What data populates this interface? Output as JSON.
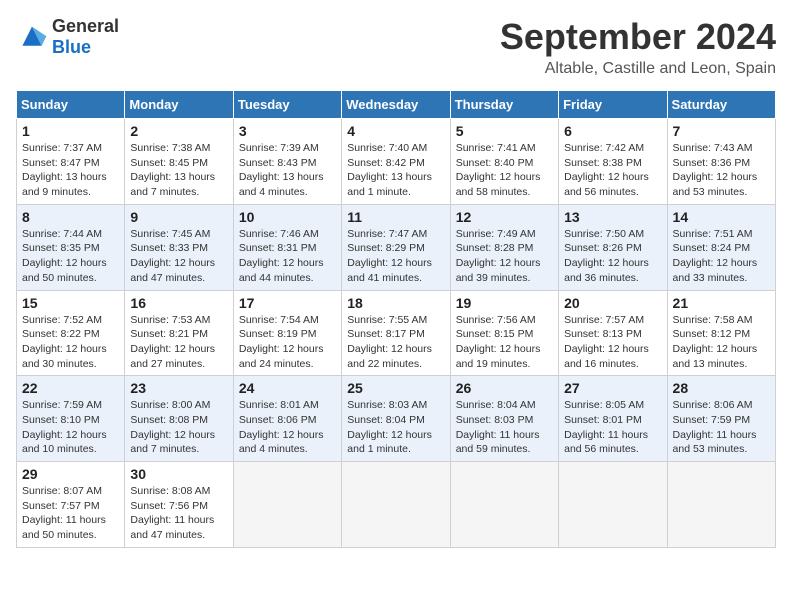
{
  "header": {
    "logo": {
      "general": "General",
      "blue": "Blue"
    },
    "title": "September 2024",
    "location": "Altable, Castille and Leon, Spain"
  },
  "calendar": {
    "headers": [
      "Sunday",
      "Monday",
      "Tuesday",
      "Wednesday",
      "Thursday",
      "Friday",
      "Saturday"
    ],
    "weeks": [
      [
        {
          "day": "1",
          "sunrise": "7:37 AM",
          "sunset": "8:47 PM",
          "daylight": "13 hours and 9 minutes."
        },
        {
          "day": "2",
          "sunrise": "7:38 AM",
          "sunset": "8:45 PM",
          "daylight": "13 hours and 7 minutes."
        },
        {
          "day": "3",
          "sunrise": "7:39 AM",
          "sunset": "8:43 PM",
          "daylight": "13 hours and 4 minutes."
        },
        {
          "day": "4",
          "sunrise": "7:40 AM",
          "sunset": "8:42 PM",
          "daylight": "13 hours and 1 minute."
        },
        {
          "day": "5",
          "sunrise": "7:41 AM",
          "sunset": "8:40 PM",
          "daylight": "12 hours and 58 minutes."
        },
        {
          "day": "6",
          "sunrise": "7:42 AM",
          "sunset": "8:38 PM",
          "daylight": "12 hours and 56 minutes."
        },
        {
          "day": "7",
          "sunrise": "7:43 AM",
          "sunset": "8:36 PM",
          "daylight": "12 hours and 53 minutes."
        }
      ],
      [
        {
          "day": "8",
          "sunrise": "7:44 AM",
          "sunset": "8:35 PM",
          "daylight": "12 hours and 50 minutes."
        },
        {
          "day": "9",
          "sunrise": "7:45 AM",
          "sunset": "8:33 PM",
          "daylight": "12 hours and 47 minutes."
        },
        {
          "day": "10",
          "sunrise": "7:46 AM",
          "sunset": "8:31 PM",
          "daylight": "12 hours and 44 minutes."
        },
        {
          "day": "11",
          "sunrise": "7:47 AM",
          "sunset": "8:29 PM",
          "daylight": "12 hours and 41 minutes."
        },
        {
          "day": "12",
          "sunrise": "7:49 AM",
          "sunset": "8:28 PM",
          "daylight": "12 hours and 39 minutes."
        },
        {
          "day": "13",
          "sunrise": "7:50 AM",
          "sunset": "8:26 PM",
          "daylight": "12 hours and 36 minutes."
        },
        {
          "day": "14",
          "sunrise": "7:51 AM",
          "sunset": "8:24 PM",
          "daylight": "12 hours and 33 minutes."
        }
      ],
      [
        {
          "day": "15",
          "sunrise": "7:52 AM",
          "sunset": "8:22 PM",
          "daylight": "12 hours and 30 minutes."
        },
        {
          "day": "16",
          "sunrise": "7:53 AM",
          "sunset": "8:21 PM",
          "daylight": "12 hours and 27 minutes."
        },
        {
          "day": "17",
          "sunrise": "7:54 AM",
          "sunset": "8:19 PM",
          "daylight": "12 hours and 24 minutes."
        },
        {
          "day": "18",
          "sunrise": "7:55 AM",
          "sunset": "8:17 PM",
          "daylight": "12 hours and 22 minutes."
        },
        {
          "day": "19",
          "sunrise": "7:56 AM",
          "sunset": "8:15 PM",
          "daylight": "12 hours and 19 minutes."
        },
        {
          "day": "20",
          "sunrise": "7:57 AM",
          "sunset": "8:13 PM",
          "daylight": "12 hours and 16 minutes."
        },
        {
          "day": "21",
          "sunrise": "7:58 AM",
          "sunset": "8:12 PM",
          "daylight": "12 hours and 13 minutes."
        }
      ],
      [
        {
          "day": "22",
          "sunrise": "7:59 AM",
          "sunset": "8:10 PM",
          "daylight": "12 hours and 10 minutes."
        },
        {
          "day": "23",
          "sunrise": "8:00 AM",
          "sunset": "8:08 PM",
          "daylight": "12 hours and 7 minutes."
        },
        {
          "day": "24",
          "sunrise": "8:01 AM",
          "sunset": "8:06 PM",
          "daylight": "12 hours and 4 minutes."
        },
        {
          "day": "25",
          "sunrise": "8:03 AM",
          "sunset": "8:04 PM",
          "daylight": "12 hours and 1 minute."
        },
        {
          "day": "26",
          "sunrise": "8:04 AM",
          "sunset": "8:03 PM",
          "daylight": "11 hours and 59 minutes."
        },
        {
          "day": "27",
          "sunrise": "8:05 AM",
          "sunset": "8:01 PM",
          "daylight": "11 hours and 56 minutes."
        },
        {
          "day": "28",
          "sunrise": "8:06 AM",
          "sunset": "7:59 PM",
          "daylight": "11 hours and 53 minutes."
        }
      ],
      [
        {
          "day": "29",
          "sunrise": "8:07 AM",
          "sunset": "7:57 PM",
          "daylight": "11 hours and 50 minutes."
        },
        {
          "day": "30",
          "sunrise": "8:08 AM",
          "sunset": "7:56 PM",
          "daylight": "11 hours and 47 minutes."
        },
        null,
        null,
        null,
        null,
        null
      ]
    ]
  }
}
